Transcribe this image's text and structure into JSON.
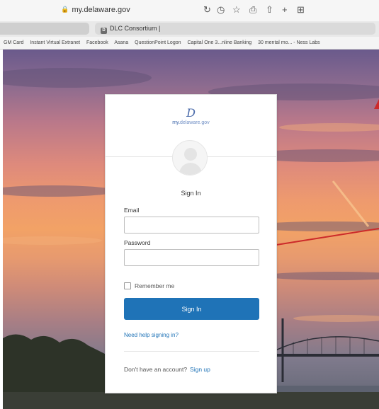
{
  "browser": {
    "url": "my.delaware.gov",
    "tab_label": "DLC Consortium |",
    "tab_favicon_letter": "D",
    "bookmarks": [
      "GM Card",
      "Instant Virtual Extranet",
      "Facebook",
      "Asana",
      "QuestionPoint Logon",
      "Capital One 3...nline Banking",
      "30 mental mo... - Ness Labs"
    ]
  },
  "login": {
    "logo_mark": "D",
    "logo_my": "my.",
    "logo_delaware": "delaware",
    "logo_gov": ".gov",
    "title": "Sign In",
    "email_label": "Email",
    "email_value": "",
    "password_label": "Password",
    "password_value": "",
    "remember_label": "Remember me",
    "submit_label": "Sign In",
    "help_link": "Need help signing in?",
    "no_account_text": "Don't have an account?",
    "signup_link": "Sign up"
  },
  "colors": {
    "primary_button": "#1f73b7",
    "link": "#1f73b7",
    "annotation_arrow": "#cc2a2a"
  }
}
